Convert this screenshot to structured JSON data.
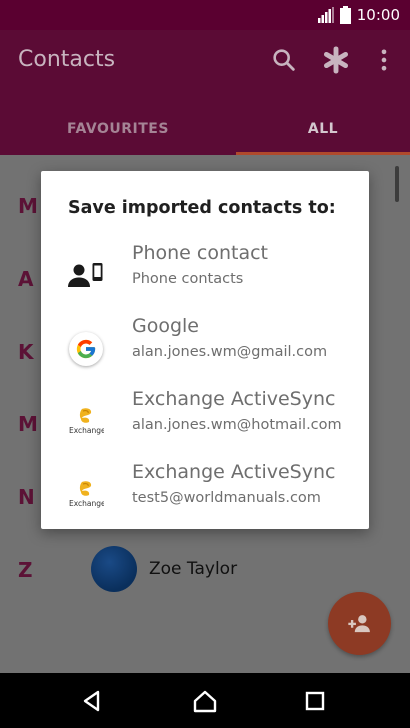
{
  "status_bar": {
    "time": "10:00"
  },
  "app_bar": {
    "title": "Contacts",
    "tabs": [
      {
        "label": "FAVOURITES"
      },
      {
        "label": "ALL"
      }
    ],
    "actions": [
      "search-icon",
      "asterisk-icon",
      "more-vert-icon"
    ]
  },
  "contact_list": {
    "letters": [
      "M",
      "A",
      "K",
      "M",
      "N",
      "Z"
    ],
    "visible_contact": {
      "name": "Zoe Taylor"
    }
  },
  "dialog": {
    "title": "Save imported contacts to:",
    "options": [
      {
        "title": "Phone contact",
        "subtitle": "Phone contacts",
        "icon": "phone-contact-icon"
      },
      {
        "title": "Google",
        "subtitle": "alan.jones.wm@gmail.com",
        "icon": "google-icon"
      },
      {
        "title": "Exchange ActiveSync",
        "subtitle": "alan.jones.wm@hotmail.com",
        "icon": "exchange-icon"
      },
      {
        "title": "Exchange ActiveSync",
        "subtitle": "test5@worldmanuals.com",
        "icon": "exchange-icon"
      }
    ]
  },
  "colors": {
    "primary": "#b5005c",
    "accent": "#e0492a"
  }
}
